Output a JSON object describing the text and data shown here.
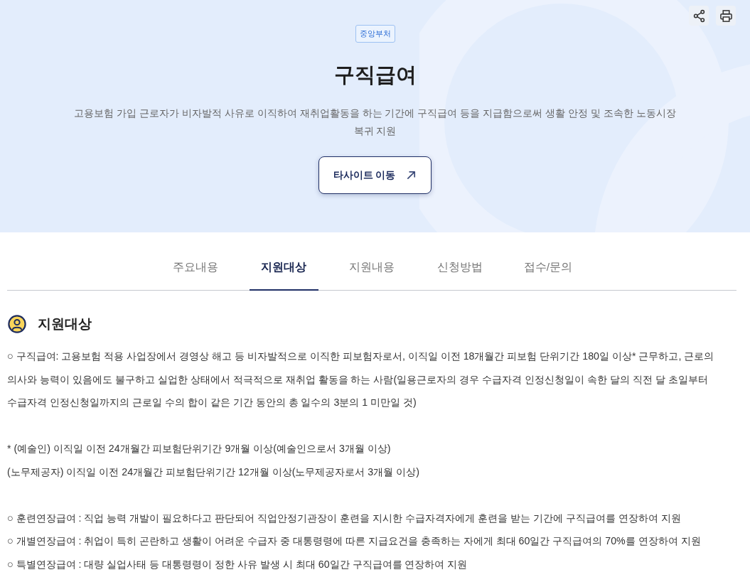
{
  "header": {
    "badge": "중앙부처",
    "title": "구직급여",
    "description": "고용보험 가입 근로자가 비자발적 사유로 이직하여 재취업활동을 하는 기간에 구직급여 등을 지급함으로써 생활 안정 및 조속한 노동시장 복귀 지원",
    "link_button": "타사이트 이동"
  },
  "tabs": [
    {
      "label": "주요내용",
      "selected": false
    },
    {
      "label": "지원대상",
      "selected": true
    },
    {
      "label": "지원내용",
      "selected": false
    },
    {
      "label": "신청방법",
      "selected": false
    },
    {
      "label": "접수/문의",
      "selected": false
    }
  ],
  "section": {
    "title": "지원대상",
    "blocks": [
      [
        "○ 구직급여: 고용보험 적용 사업장에서 경영상 해고 등 비자발적으로 이직한 피보험자로서, 이직일 이전 18개월간 피보험 단위기간 180일 이상* 근무하고, 근로의 의사와 능력이 있음에도 불구하고 실업한 상태에서 적극적으로 재취업 활동을 하는 사람(일용근로자의 경우 수급자격 인정신청일이 속한 달의 직전 달 초일부터 수급자격 인정신청일까지의 근로일 수의 합이 같은 기간 동안의 총 일수의 3분의 1 미만일 것)"
      ],
      [
        "* (예술인) 이직일 이전 24개월간 피보험단위기간 9개월 이상(예술인으로서 3개월 이상)",
        "(노무제공자) 이직일 이전 24개월간 피보험단위기간 12개월 이상(노무제공자로서 3개월 이상)"
      ],
      [
        "○ 훈련연장급여 : 직업 능력 개발이 필요하다고 판단되어 직업안정기관장이 훈련을 지시한 수급자격자에게 훈련을 받는 기간에 구직급여를 연장하여 지원",
        "○ 개별연장급여 : 취업이 특히 곤란하고 생활이 어려운 수급자 중 대통령령에 따른 지급요건을 충족하는 자에게 최대 60일간 구직급여의 70%를 연장하여 지원",
        "○ 특별연장급여 : 대량 실업사태 등 대통령령이 정한 사유 발생 시 최대 60일간 구직급여를 연장하여 지원"
      ]
    ]
  }
}
